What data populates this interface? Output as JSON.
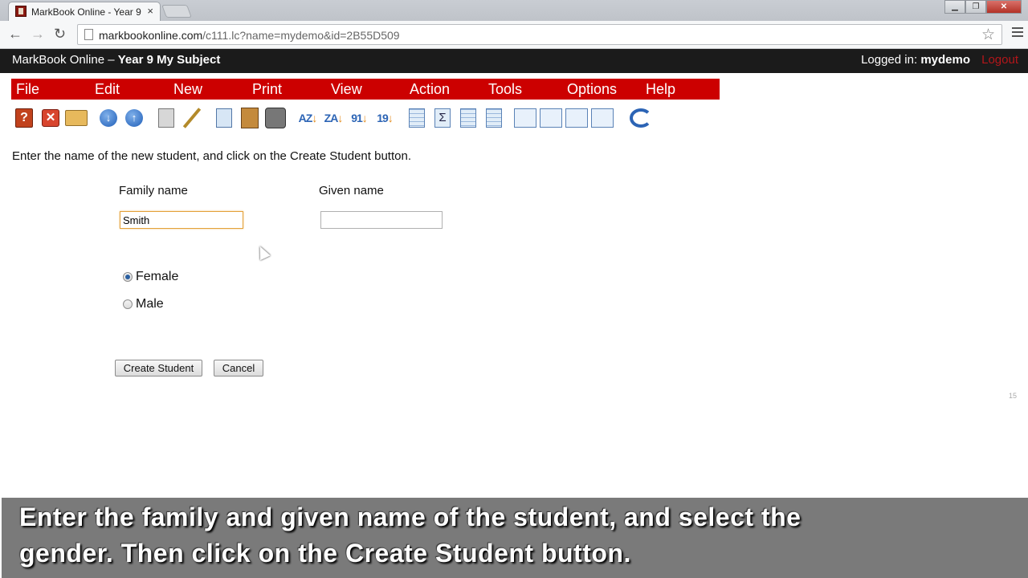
{
  "browser": {
    "tab_title": "MarkBook Online - Year 9",
    "tab_close": "×",
    "url_host": "markbookonline.com",
    "url_path": "/c111.lc?name=mydemo&id=2B55D509",
    "back": "←",
    "forward": "→",
    "reload": "↻",
    "star": "☆"
  },
  "header": {
    "app_name": "MarkBook Online",
    "separator": " – ",
    "subject": "Year 9 My Subject",
    "login_label": "Logged in:",
    "user": "mydemo",
    "logout": "Logout"
  },
  "menu": [
    "File",
    "Edit",
    "New",
    "Print",
    "View",
    "Action",
    "Tools",
    "Options",
    "Help"
  ],
  "toolbar_icons": [
    "help-icon",
    "delete-icon",
    "open-folder-icon",
    "download-icon",
    "upload-icon",
    "calculator-icon",
    "magic-wand-icon",
    "copy-icon",
    "paste-icon",
    "find-icon",
    "sort-az-icon",
    "sort-za-icon",
    "sort-91-icon",
    "sort-19-icon",
    "grid-icon",
    "sum-icon",
    "rows-icon",
    "table-icon",
    "bar-chart-icon",
    "area-chart-icon",
    "scatter-chart-icon",
    "horizontal-bar-icon",
    "refresh-icon"
  ],
  "form": {
    "instruction": "Enter the name of the new student, and click on the Create Student button.",
    "family_label": "Family name",
    "family_value": "Smith",
    "given_label": "Given name",
    "given_value": "",
    "gender_options": [
      "Female",
      "Male"
    ],
    "gender_selected": "Female",
    "create_button": "Create Student",
    "cancel_button": "Cancel",
    "page_number": "15"
  },
  "caption": {
    "line1": "Enter the family and given name of the student, and select the",
    "line2": "gender. Then click on the Create Student button."
  },
  "colors": {
    "menubar": "#cc0000",
    "header": "#1b1b1b",
    "logout": "#b3161a"
  }
}
